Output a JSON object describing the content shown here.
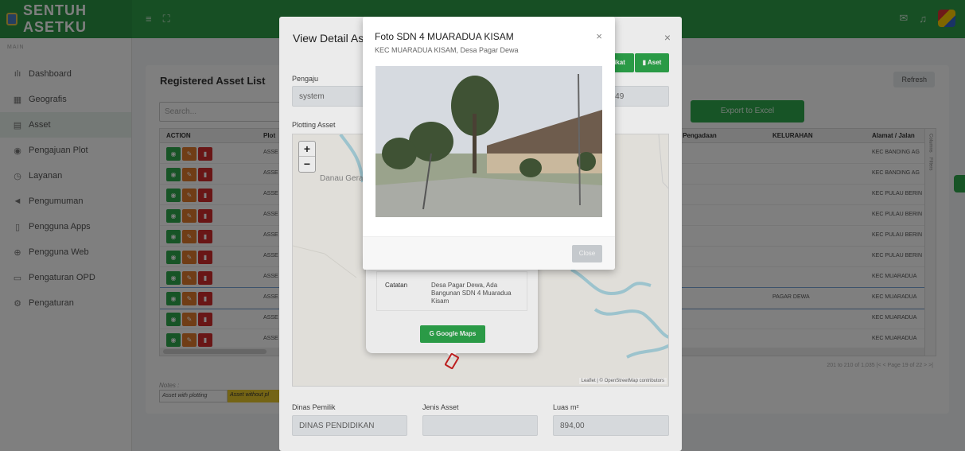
{
  "app": {
    "brand": "SENTUH ASETKU"
  },
  "topbar": {
    "left_icons": [
      "menu-icon",
      "expand-icon"
    ],
    "right_icons": [
      "mail-icon",
      "bell-icon",
      "avatar"
    ]
  },
  "sidebar": {
    "caption": "MAIN",
    "items": [
      {
        "label": "Dashboard",
        "icon": "chart-icon"
      },
      {
        "label": "Geografis",
        "icon": "map-icon"
      },
      {
        "label": "Asset",
        "icon": "grid-icon",
        "active": true
      },
      {
        "label": "Pengajuan Plot",
        "icon": "pin-icon"
      },
      {
        "label": "Layanan",
        "icon": "clock-icon"
      },
      {
        "label": "Pengumuman",
        "icon": "megaphone-icon"
      },
      {
        "label": "Pengguna Apps",
        "icon": "phone-icon"
      },
      {
        "label": "Pengguna Web",
        "icon": "globe-icon"
      },
      {
        "label": "Pengaturan OPD",
        "icon": "monitor-icon"
      },
      {
        "label": "Pengaturan",
        "icon": "gear-icon"
      }
    ]
  },
  "list": {
    "title": "Registered Asset List",
    "refresh": "Refresh",
    "search_placeholder": "Search...",
    "export": "Export to Excel",
    "headers": {
      "action": "ACTION",
      "plot": "Plot",
      "pengadaan": "n Pengadaan",
      "kelurahan": "KELURAHAN",
      "alamat": "Alamat / Jalan"
    },
    "rows": [
      {
        "plot": "ASSE",
        "kelurahan": "",
        "alamat": "KEC BANDING AG"
      },
      {
        "plot": "ASSE",
        "kelurahan": "",
        "alamat": "KEC BANDING AG"
      },
      {
        "plot": "ASSE",
        "kelurahan": "",
        "alamat": "KEC PULAU BERIN"
      },
      {
        "plot": "ASSE",
        "kelurahan": "",
        "alamat": "KEC PULAU BERIN"
      },
      {
        "plot": "ASSE",
        "kelurahan": "",
        "alamat": "KEC PULAU BERIN"
      },
      {
        "plot": "ASSE",
        "kelurahan": "",
        "alamat": "KEC PULAU BERIN"
      },
      {
        "plot": "ASSE",
        "kelurahan": "",
        "alamat": "KEC MUARADUA"
      },
      {
        "plot": "ASSE",
        "kelurahan": "PAGAR DEWA",
        "alamat": "KEC MUARADUA",
        "highlight": true
      },
      {
        "plot": "ASSE",
        "kelurahan": "",
        "alamat": "KEC MUARADUA"
      },
      {
        "plot": "ASSE",
        "kelurahan": "",
        "alamat": "KEC MUARADUA"
      }
    ],
    "side_panel": [
      "Columns",
      "Filters"
    ],
    "pager": "201 to 210 of 1,035   |<  <  Page 19 of 22  >  >|",
    "notes_label": "Notes :",
    "legend": [
      "Asset with plotting",
      "Asset without pl"
    ]
  },
  "detail_modal": {
    "title": "View Detail Asset",
    "btn_sertifikat": "ikat",
    "btn_asset": "Aset",
    "pengaju_label": "Pengaju",
    "pengaju_value": "system",
    "time_value": "11:49",
    "plotting_label": "Plotting Asset",
    "map": {
      "zoom_in": "+",
      "zoom_out": "−",
      "place_label": "Danau Gerak",
      "attribution": "Leaflet | © OpenStreetMap contributors",
      "popup": {
        "key": "Catatan",
        "value": "Desa Pagar Dewa, Ada Bangunan SDN 4 Muaradua Kisam",
        "gmaps": "Google Maps"
      }
    },
    "dinas_label": "Dinas Pemilik",
    "dinas_value": "DINAS PENDIDIKAN",
    "jenis_label": "Jenis Asset",
    "jenis_value": "",
    "luas_label": "Luas m²",
    "luas_value": "894,00"
  },
  "photo_modal": {
    "title": "Foto SDN 4 MUARADUA KISAM",
    "subtitle": "KEC MUARADUA KISAM, Desa Pagar Dewa",
    "close_x": "×",
    "close_button": "Close"
  },
  "colors": {
    "brand_green": "#2e9e48",
    "danger": "#d22c2c",
    "warning": "#e07b2c",
    "legend_yellow": "#e8c92a"
  }
}
